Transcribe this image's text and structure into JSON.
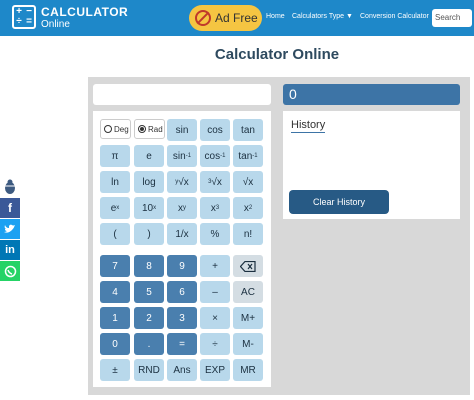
{
  "header": {
    "logo_symbols": [
      "+",
      "−",
      "÷",
      "="
    ],
    "logo_title": "CALCULATOR",
    "logo_subtitle": "Online",
    "ad_free": "Ad Free",
    "nav": [
      "Home",
      "Calculators Type ▼",
      "Conversion Calculator"
    ],
    "search_placeholder": "Search"
  },
  "page_title": "Calculator Online",
  "display": {
    "result": "0"
  },
  "history": {
    "title": "History",
    "clear_label": "Clear History"
  },
  "modes": {
    "deg": "Deg",
    "rad": "Rad",
    "selected": "Rad"
  },
  "keys": {
    "sin": "sin",
    "cos": "cos",
    "tan": "tan",
    "pi": "π",
    "e": "e",
    "ln": "ln",
    "log": "log",
    "ex_base": "e",
    "ex_sup": "x",
    "tenx_base": "10",
    "tenx_sup": "x",
    "xy_base": "x",
    "xy_sup": "y",
    "x3_base": "x",
    "x3_sup": "3",
    "x2_base": "x",
    "x2_sup": "2",
    "asin_base": "sin",
    "asin_sup": "-1",
    "acos_base": "cos",
    "acos_sup": "-1",
    "atan_base": "tan",
    "atan_sup": "-1",
    "yroot_sup": "y",
    "yroot_base": "√x",
    "cbrt_sup": "3",
    "cbrt_base": "√x",
    "sqrt": "√x",
    "open_paren": "(",
    "close_paren": ")",
    "reciprocal": "1/x",
    "percent": "%",
    "factorial": "n!",
    "n7": "7",
    "n8": "8",
    "n9": "9",
    "plus": "+",
    "n4": "4",
    "n5": "5",
    "n6": "6",
    "minus": "–",
    "ac": "AC",
    "n1": "1",
    "n2": "2",
    "n3": "3",
    "times": "×",
    "mplus": "M+",
    "n0": "0",
    "dot": ".",
    "equals": "=",
    "divide": "÷",
    "mminus": "M-",
    "pm": "±",
    "rnd": "RND",
    "ans": "Ans",
    "exp": "EXP",
    "mr": "MR"
  },
  "colors": {
    "header": "#1e88c9",
    "accent": "#3d74a6",
    "ad_badge": "#f5c542"
  }
}
